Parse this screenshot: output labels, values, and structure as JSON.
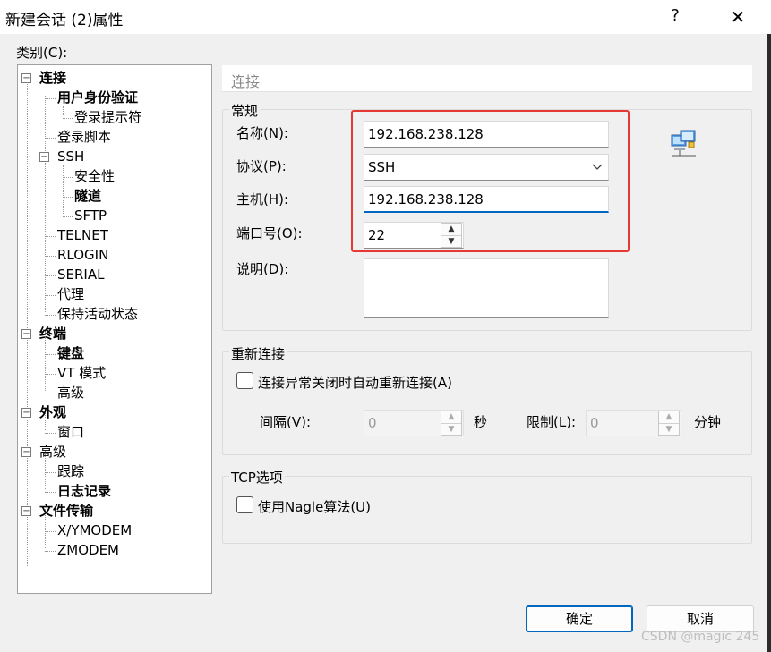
{
  "window": {
    "title": "新建会话 (2)属性",
    "help_glyph": "?",
    "close_glyph": "✕"
  },
  "category_label": "类别(C):",
  "tree": [
    {
      "label": "连接",
      "bold": true,
      "expander": "−"
    },
    {
      "label": "用户身份验证",
      "bold": true
    },
    {
      "label": "登录提示符",
      "bold": false
    },
    {
      "label": "登录脚本",
      "bold": false
    },
    {
      "label": "SSH",
      "bold": false,
      "expander": "−"
    },
    {
      "label": "安全性",
      "bold": false
    },
    {
      "label": "隧道",
      "bold": true
    },
    {
      "label": "SFTP",
      "bold": false
    },
    {
      "label": "TELNET",
      "bold": false
    },
    {
      "label": "RLOGIN",
      "bold": false
    },
    {
      "label": "SERIAL",
      "bold": false
    },
    {
      "label": "代理",
      "bold": false
    },
    {
      "label": "保持活动状态",
      "bold": false
    },
    {
      "label": "终端",
      "bold": true,
      "expander": "−"
    },
    {
      "label": "键盘",
      "bold": true
    },
    {
      "label": "VT 模式",
      "bold": false
    },
    {
      "label": "高级",
      "bold": false
    },
    {
      "label": "外观",
      "bold": true,
      "expander": "−"
    },
    {
      "label": "窗口",
      "bold": false
    },
    {
      "label": "高级",
      "bold": false,
      "expander": "−"
    },
    {
      "label": "跟踪",
      "bold": false
    },
    {
      "label": "日志记录",
      "bold": true
    },
    {
      "label": "文件传输",
      "bold": true,
      "expander": "−"
    },
    {
      "label": "X/YMODEM",
      "bold": false
    },
    {
      "label": "ZMODEM",
      "bold": false
    }
  ],
  "header": {
    "title": "连接"
  },
  "general": {
    "title": "常规",
    "name_label": "名称(N):",
    "name_value": "192.168.238.128",
    "protocol_label": "协议(P):",
    "protocol_value": "SSH",
    "host_label": "主机(H):",
    "host_value": "192.168.238.128",
    "port_label": "端口号(O):",
    "port_value": "22",
    "desc_label": "说明(D):",
    "desc_value": ""
  },
  "reconnect": {
    "title": "重新连接",
    "checkbox_label": "连接异常关闭时自动重新连接(A)",
    "interval_label": "间隔(V):",
    "interval_value": "0",
    "interval_unit": "秒",
    "limit_label": "限制(L):",
    "limit_value": "0",
    "limit_unit": "分钟"
  },
  "tcp": {
    "title": "TCP选项",
    "nagle_label": "使用Nagle算法(U)"
  },
  "buttons": {
    "ok": "确定",
    "cancel": "取消"
  },
  "watermark": "CSDN @magic 245",
  "colors": {
    "accent": "#0067c0",
    "highlight_box": "#e53935"
  }
}
